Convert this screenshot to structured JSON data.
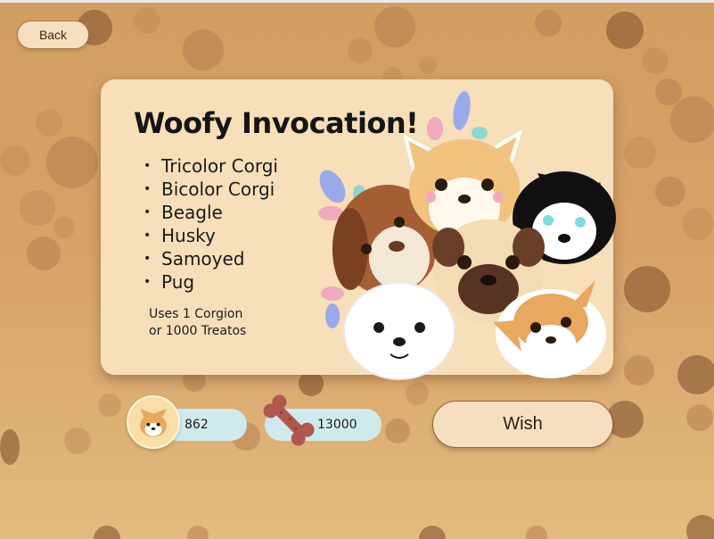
{
  "header": {
    "back_label": "Back"
  },
  "banner": {
    "title": "Woofy Invocation!",
    "breeds": [
      "Tricolor Corgi",
      "Bicolor Corgi",
      "Beagle",
      "Husky",
      "Samoyed",
      "Pug"
    ],
    "bullet": "•",
    "cost_line1": "Uses 1 Corgion",
    "cost_line2": "or 1000 Treatos"
  },
  "currency": {
    "corgion_count": "862",
    "treato_count": "13000"
  },
  "actions": {
    "wish_label": "Wish"
  },
  "colors": {
    "background": "#d6a267",
    "card": "#f6dfb9",
    "pill": "#cfeaec",
    "button": "#f6dfbf",
    "bone": "#b0574f"
  }
}
